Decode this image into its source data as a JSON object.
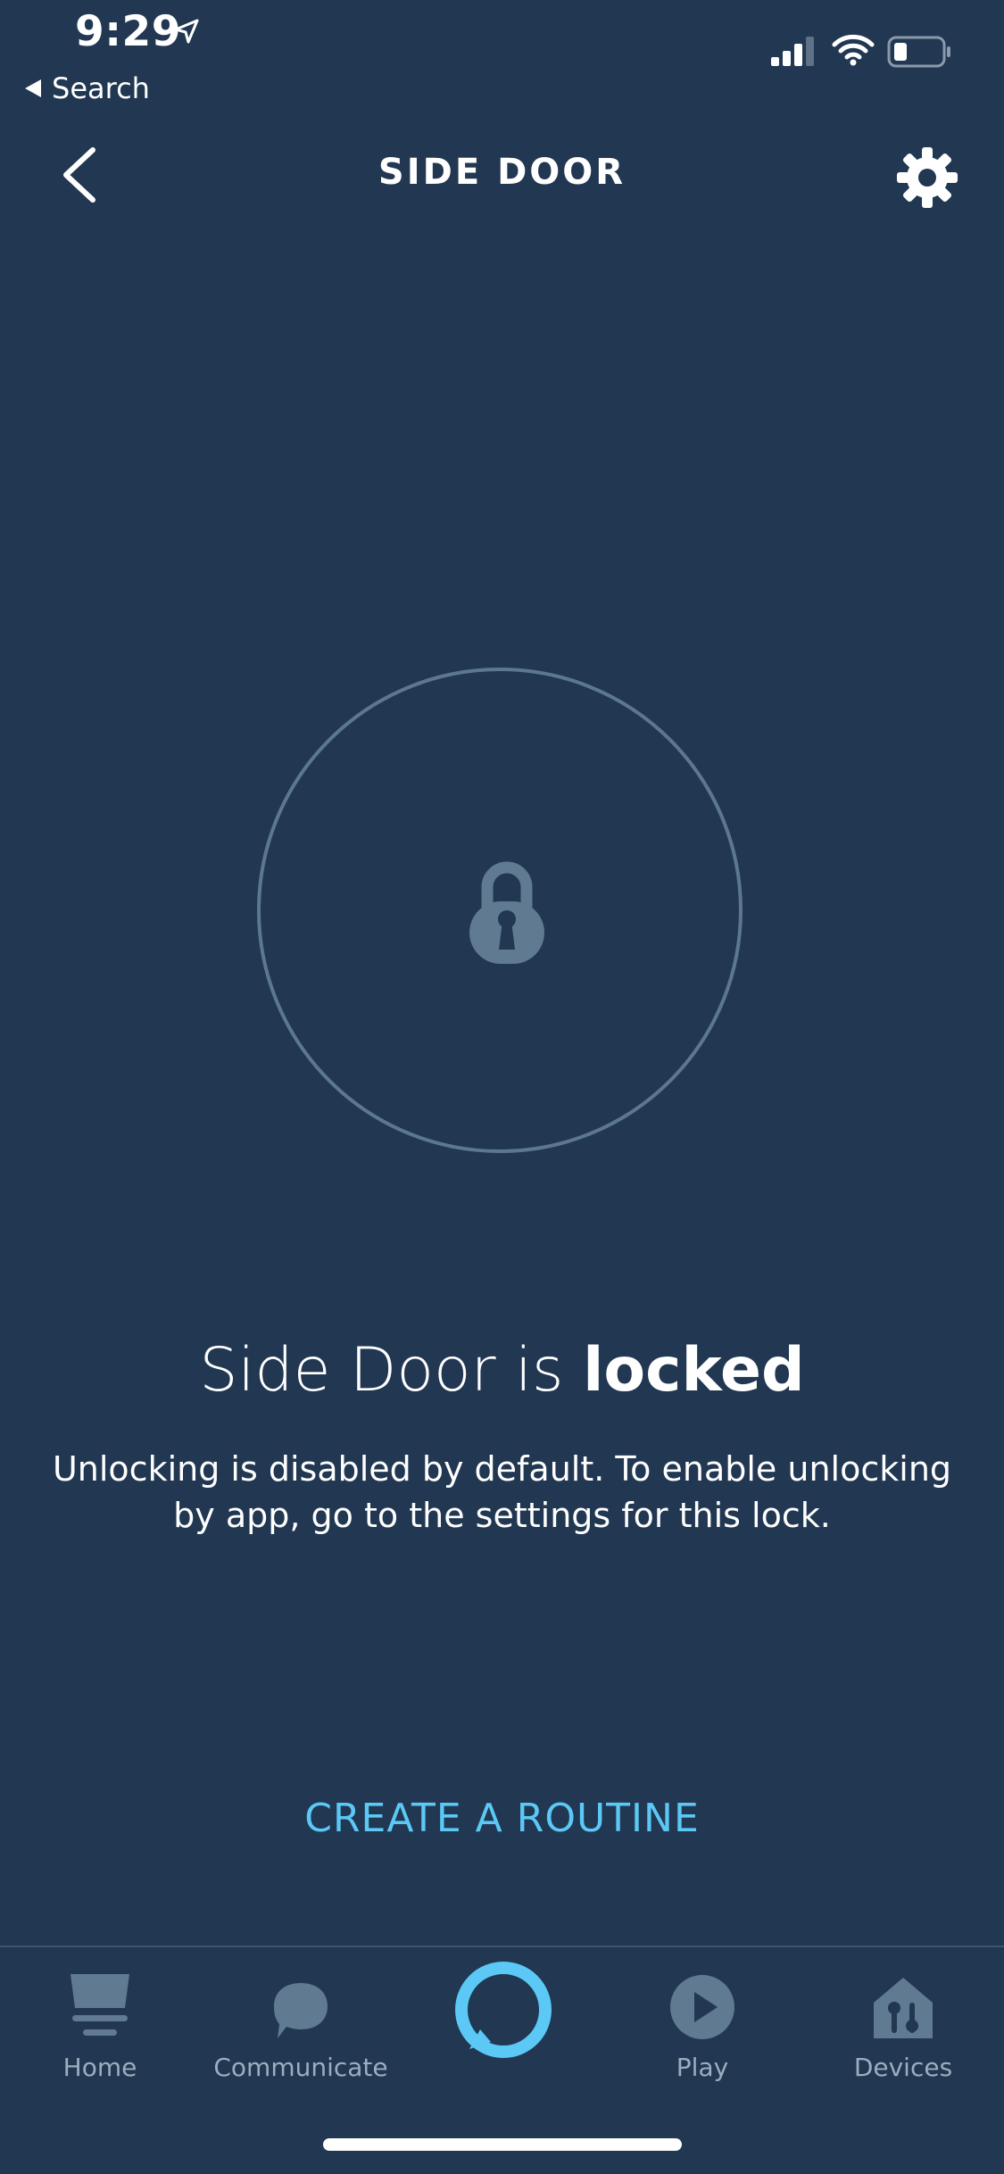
{
  "status_bar": {
    "time": "9:29",
    "back_app_label": "Search"
  },
  "nav": {
    "title": "SIDE DOOR"
  },
  "lock": {
    "device_name": "Side Door",
    "state_prefix": " is ",
    "state": "locked",
    "description": "Unlocking is disabled by default. To enable unlocking by app, go to the settings for this lock."
  },
  "actions": {
    "create_routine": "CREATE A ROUTINE"
  },
  "tab_bar": {
    "items": [
      {
        "label": "Home",
        "icon": "home-icon"
      },
      {
        "label": "Communicate",
        "icon": "chat-bubble-icon"
      },
      {
        "label": "",
        "icon": "alexa-icon"
      },
      {
        "label": "Play",
        "icon": "play-icon"
      },
      {
        "label": "Devices",
        "icon": "devices-icon"
      }
    ]
  },
  "colors": {
    "background": "#213752",
    "accent": "#5bc8f5",
    "icon_muted": "#607a92",
    "label_muted": "#9aaebf"
  }
}
